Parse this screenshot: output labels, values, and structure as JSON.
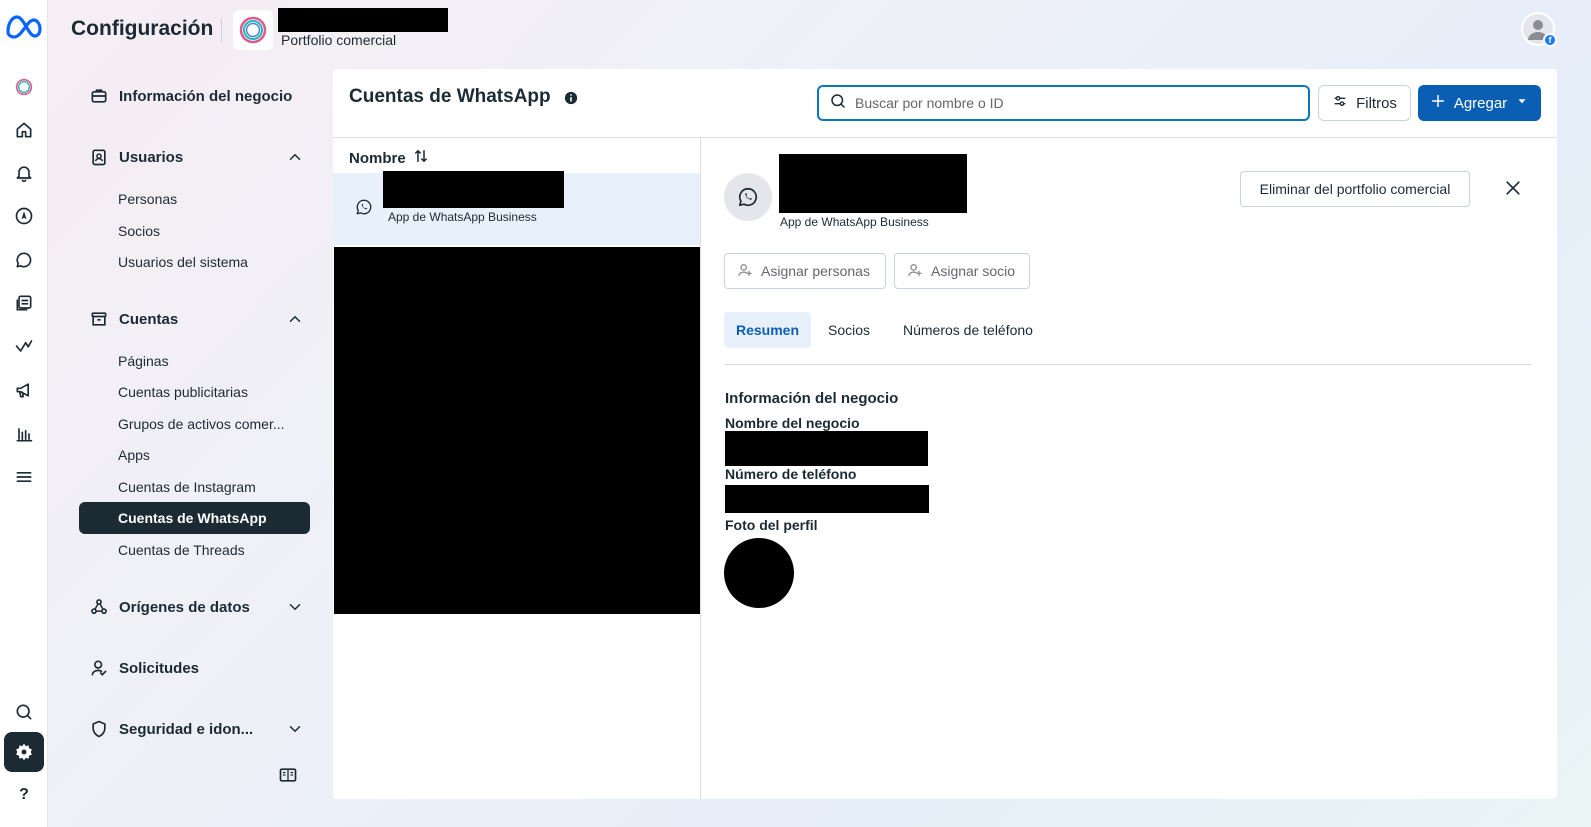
{
  "header": {
    "title": "Configuración",
    "portfolio_subtitle": "Portfolio comercial"
  },
  "sidebar": {
    "sections": {
      "business_info": "Información del negocio",
      "users": "Usuarios",
      "accounts": "Cuentas",
      "data_sources": "Orígenes de datos",
      "requests": "Solicitudes",
      "security": "Seguridad e idon..."
    },
    "user_items": [
      "Personas",
      "Socios",
      "Usuarios del sistema"
    ],
    "account_items": [
      "Páginas",
      "Cuentas publicitarias",
      "Grupos de activos comer...",
      "Apps",
      "Cuentas de Instagram",
      "Cuentas de WhatsApp",
      "Cuentas de Threads"
    ]
  },
  "main": {
    "title": "Cuentas de WhatsApp",
    "search_placeholder": "Buscar por nombre o ID",
    "filters_label": "Filtros",
    "add_label": "Agregar",
    "column_name": "Nombre",
    "selected_row_subtitle": "App de WhatsApp Business"
  },
  "detail": {
    "subtitle": "App de WhatsApp Business",
    "remove_label": "Eliminar del portfolio comercial",
    "assign_people_label": "Asignar personas",
    "assign_partner_label": "Asignar socio",
    "tabs": [
      "Resumen",
      "Socios",
      "Números de teléfono"
    ],
    "active_tab": "Resumen",
    "section_title": "Información del negocio",
    "business_name_label": "Nombre del negocio",
    "phone_label": "Número de teléfono",
    "profile_photo_label": "Foto del perfil"
  },
  "colors": {
    "primary": "#0a5fb4",
    "active_nav": "#1c2b33",
    "selected_row": "#e7f0fb"
  }
}
